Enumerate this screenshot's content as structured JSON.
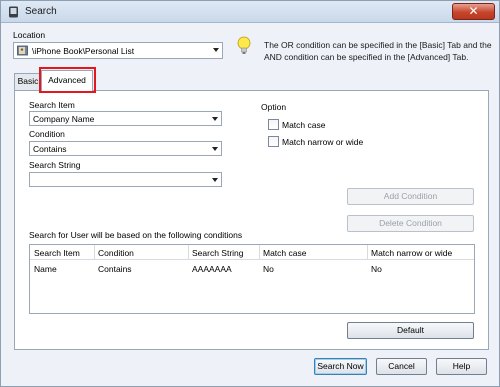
{
  "window": {
    "title": "Search",
    "close_glyph": "✕"
  },
  "location": {
    "label": "Location",
    "value": "\\iPhone Book\\Personal List",
    "icon": "address-book-icon"
  },
  "info": {
    "icon": "lightbulb-icon",
    "text": "The OR condition can be specified in the [Basic] Tab and the AND condition can be specified in the [Advanced] Tab."
  },
  "tabs": [
    {
      "label": "Basic"
    },
    {
      "label": "Advanced",
      "selected": true
    }
  ],
  "search_item": {
    "label": "Search Item",
    "value": "Company Name"
  },
  "condition": {
    "label": "Condition",
    "value": "Contains"
  },
  "search_string": {
    "label": "Search String",
    "value": ""
  },
  "option": {
    "title": "Option",
    "match_case": {
      "label": "Match case",
      "checked": false
    },
    "match_narrow_wide": {
      "label": "Match narrow or wide",
      "checked": false
    }
  },
  "buttons": {
    "add_condition": "Add Condition",
    "delete_condition": "Delete Condition",
    "default": "Default",
    "search_now": "Search Now",
    "cancel": "Cancel",
    "help": "Help"
  },
  "conditions": {
    "caption": "Search for User will be based on the following conditions",
    "columns": [
      "Search Item",
      "Condition",
      "Search String",
      "Match case",
      "Match narrow or wide"
    ],
    "rows": [
      [
        "Name",
        "Contains",
        "AAAAAAA",
        "No",
        "No"
      ]
    ]
  },
  "colors": {
    "highlight": "#e3171e",
    "accent": "#3c7fb1"
  }
}
